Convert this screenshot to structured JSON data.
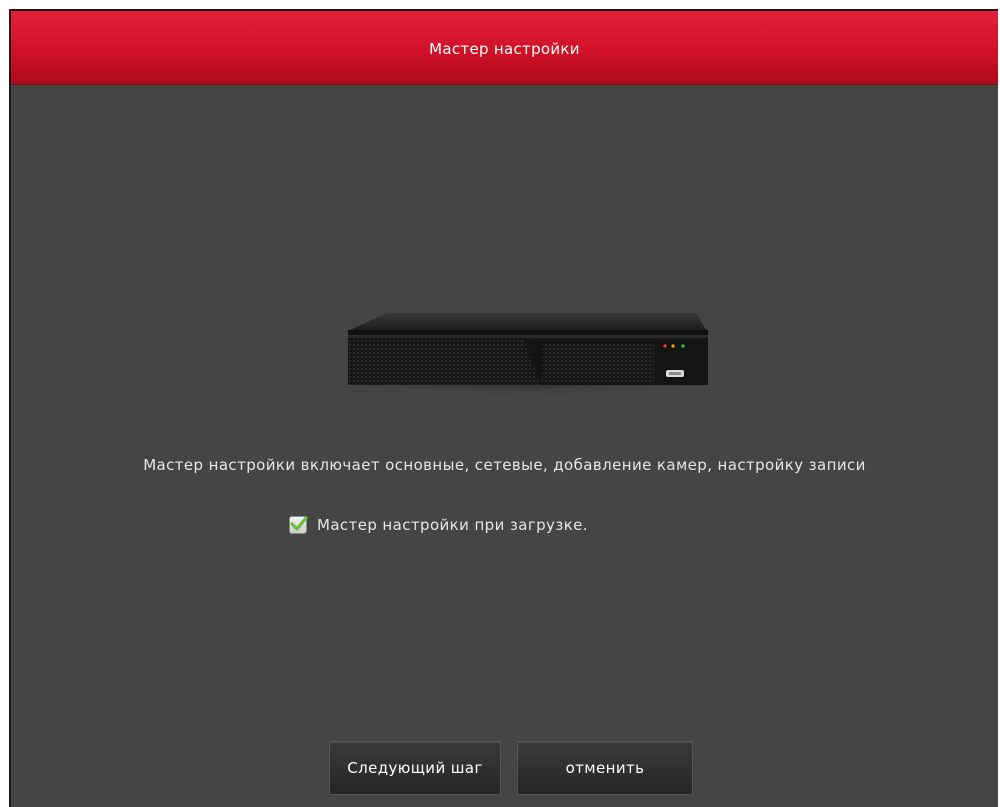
{
  "dialog": {
    "title": "Мастер настройки",
    "description": "Мастер настройки включает основные, сетевые, добавление камер, настройку записи",
    "startup_checkbox": {
      "label": "Мастер настройки при загрузке.",
      "checked": true
    },
    "buttons": {
      "next_label": "Следующий шаг",
      "cancel_label": "отменить"
    },
    "device_image": "dvr-recorder-image"
  },
  "colors": {
    "titlebar": "#cf1126",
    "background": "#454545",
    "text": "#e6e6e6",
    "button": "#2e2e2e",
    "checkmark": "#6bbf3a"
  }
}
